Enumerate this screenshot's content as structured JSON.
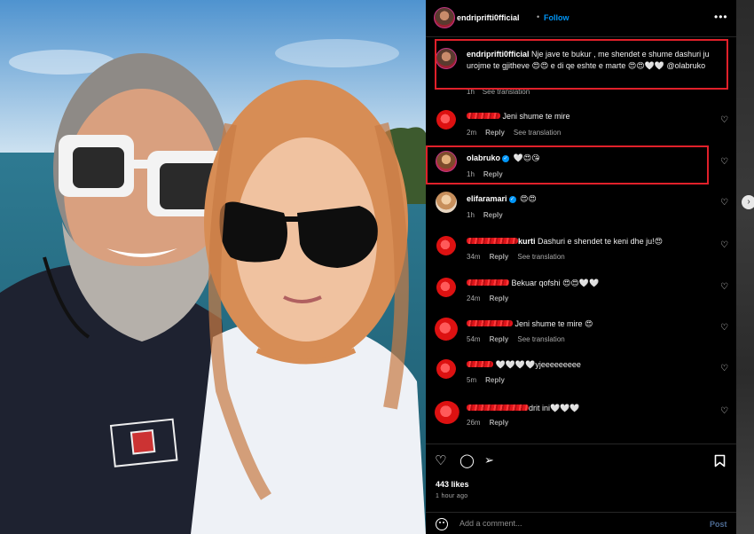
{
  "header": {
    "username": "endriprifti0fficial",
    "separator": "•",
    "follow_label": "Follow",
    "more_label": "•••"
  },
  "caption": {
    "username": "endriprifti0fficial",
    "text": "Nje jave te bukur , me shendet e shume dashuri ju urojme te gjitheve 😍😍 e di qe eshte e marte 😍😍🤍🤍 @olabruko",
    "time": "1h",
    "see_translation": "See translation"
  },
  "comments": [
    {
      "username_hidden": true,
      "text": "Jeni shume te mire",
      "time": "2m",
      "reply": "Reply",
      "translation": "See translation",
      "avatar": "red"
    },
    {
      "username": "olabruko",
      "verified": true,
      "text": "🤍😍😘",
      "time": "1h",
      "reply": "Reply",
      "avatar": "ola"
    },
    {
      "username": "elifaramari",
      "verified": true,
      "text": "😍😍",
      "time": "1h",
      "reply": "Reply",
      "avatar": "elifa"
    },
    {
      "username_partial": "kurti",
      "text": "Dashuri e shendet te keni dhe ju!😍",
      "time": "34m",
      "reply": "Reply",
      "translation": "See translation",
      "avatar": "red"
    },
    {
      "username_hidden": true,
      "text": "Bekuar qofshi 😍😍🤍🤍",
      "time": "24m",
      "reply": "Reply",
      "avatar": "red"
    },
    {
      "username_hidden": true,
      "text": "Jeni shume te mire 😍",
      "time": "54m",
      "reply": "Reply",
      "translation": "See translation",
      "avatar": "red"
    },
    {
      "username_hidden": true,
      "text": "🤍🤍🤍🤍yjeeeeeeeee",
      "time": "5m",
      "reply": "Reply",
      "avatar": "red"
    },
    {
      "username_partial": "drit ini",
      "text": "🤍🤍🤍",
      "time": "26m",
      "reply": "Reply",
      "avatar": "red"
    }
  ],
  "heart_icon": "♡",
  "actions": {
    "likes": "443 likes",
    "time_ago": "1 hour ago",
    "like_icon": "heart-icon",
    "comment_icon": "comment-icon",
    "share_icon": "share-icon",
    "save_icon": "bookmark-icon"
  },
  "add_comment": {
    "placeholder": "Add a comment...",
    "post_label": "Post"
  },
  "colors": {
    "accent": "#0095f6",
    "highlight_box": "#e0202a",
    "background": "#000000"
  }
}
